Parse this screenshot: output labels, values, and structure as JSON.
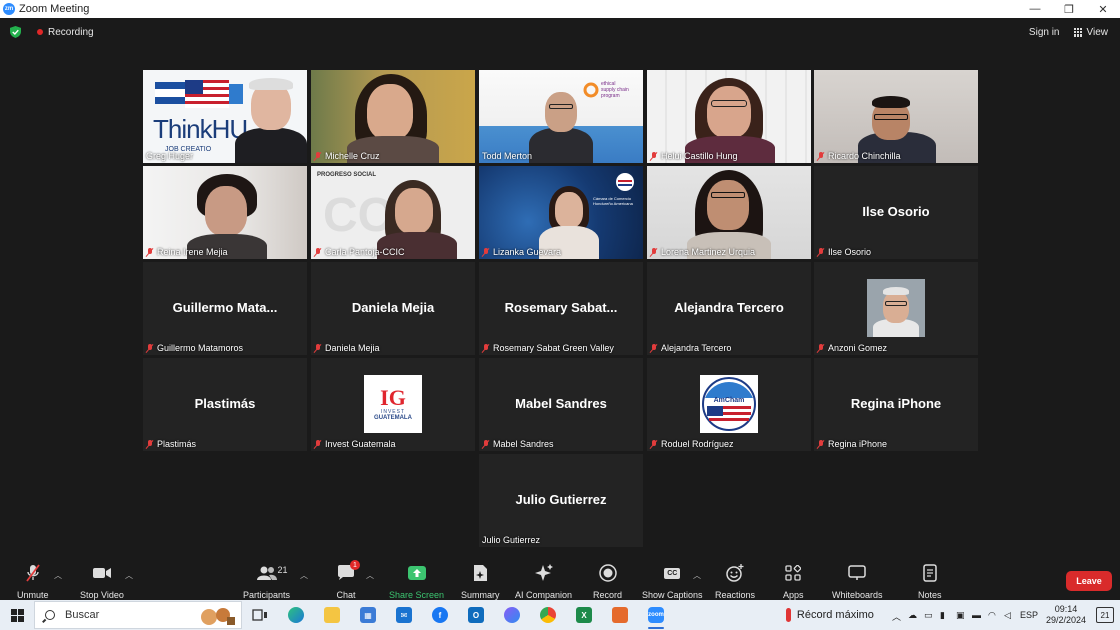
{
  "window": {
    "title": "Zoom Meeting",
    "minimize": "—",
    "restore": "❐",
    "close": "✕"
  },
  "topbar": {
    "recording": "Recording",
    "sign_in": "Sign in",
    "view": "View"
  },
  "participants": [
    {
      "name": "Greg Huger",
      "label": "Greg Huger",
      "type": "video",
      "active": true,
      "muted": false
    },
    {
      "name": "Michelle Cruz",
      "label": "Michelle Cruz",
      "type": "video",
      "muted": true
    },
    {
      "name": "Todd Merton",
      "label": "Todd Merton",
      "type": "video",
      "muted": false
    },
    {
      "name": "Helui Castillo Hung",
      "label": "Helui Castillo Hung",
      "type": "video",
      "muted": true
    },
    {
      "name": "Ricardo Chinchilla",
      "label": "Ricardo Chinchilla",
      "type": "video",
      "muted": true
    },
    {
      "name": "Reina Irene Mejia",
      "label": "Reina Irene Mejia",
      "type": "video",
      "muted": true
    },
    {
      "name": "Carla Pantoja-CCIC",
      "label": "Carla Pantoja-CCIC",
      "type": "video",
      "muted": true
    },
    {
      "name": "Lizanka Guevara",
      "label": "Lizanka Guevara",
      "type": "video",
      "muted": true
    },
    {
      "name": "Lorena Martinez Urquia",
      "label": "Lorena Martinez Urquia",
      "type": "video",
      "muted": true
    },
    {
      "name": "Ilse Osorio",
      "big": "Ilse Osorio",
      "label": "Ilse Osorio",
      "type": "name",
      "muted": true
    },
    {
      "name": "Guillermo Matamoros",
      "big": "Guillermo  Mata...",
      "label": "Guillermo Matamoros",
      "type": "name",
      "muted": true
    },
    {
      "name": "Daniela Mejia",
      "big": "Daniela Mejia",
      "label": "Daniela Mejia",
      "type": "name",
      "muted": true
    },
    {
      "name": "Rosemary Sabat Green Valley",
      "big": "Rosemary  Sabat...",
      "label": "Rosemary Sabat Green Valley",
      "type": "name",
      "muted": true
    },
    {
      "name": "Alejandra Tercero",
      "big": "Alejandra Tercero",
      "label": "Alejandra Tercero",
      "type": "name",
      "muted": true
    },
    {
      "name": "Anzoni Gomez",
      "label": "Anzoni Gomez",
      "type": "avatar-photo",
      "muted": true
    },
    {
      "name": "Plastimás",
      "big": "Plastimás",
      "label": "Plastimás",
      "type": "name",
      "muted": true
    },
    {
      "name": "Invest Guatemala",
      "label": "Invest Guatemala",
      "type": "avatar-logo",
      "logo_text": "INVEST",
      "logo_text2": "GUATEMALA",
      "muted": true
    },
    {
      "name": "Mabel Sandres",
      "big": "Mabel Sandres",
      "label": "Mabel Sandres",
      "type": "name",
      "muted": true
    },
    {
      "name": "Roduel Rodríguez",
      "label": "Roduel Rodríguez",
      "type": "avatar-amcham",
      "logo_text": "AmCham",
      "muted": true
    },
    {
      "name": "Regina iPhone",
      "big": "Regina iPhone",
      "label": "Regina iPhone",
      "type": "name",
      "muted": true
    },
    {
      "name": "Julio Gutierrez",
      "big": "Julio Gutierrez",
      "label": "Julio Gutierrez",
      "type": "name",
      "muted": false
    }
  ],
  "tile_text": {
    "thinkhuge": "ThinkHU",
    "jobcreation": "JOB CREATIO",
    "ethical": "ethical",
    "supply_chain": "supply chain",
    "program": "program",
    "progreso": "PROGRESO SOCIAL",
    "camara": "Cámara de Comercio Hondureño Americana"
  },
  "toolbar": {
    "unmute": "Unmute",
    "stop_video": "Stop Video",
    "participants": "Participants",
    "participants_count": "21",
    "chat": "Chat",
    "chat_badge": "1",
    "share_screen": "Share Screen",
    "summary": "Summary",
    "ai_companion": "AI Companion",
    "record": "Record",
    "show_captions": "Show Captions",
    "reactions": "Reactions",
    "apps": "Apps",
    "whiteboards": "Whiteboards",
    "notes": "Notes",
    "leave": "Leave",
    "cc": "CC"
  },
  "taskbar": {
    "search_placeholder": "Buscar",
    "weather": "Récord máximo",
    "lang": "ESP",
    "time": "09:14",
    "date": "29/2/2024",
    "notifications": "21"
  },
  "colors": {
    "accent_green": "#3cc470",
    "leave_red": "#d92b2b",
    "active_border": "#c8e24a"
  }
}
